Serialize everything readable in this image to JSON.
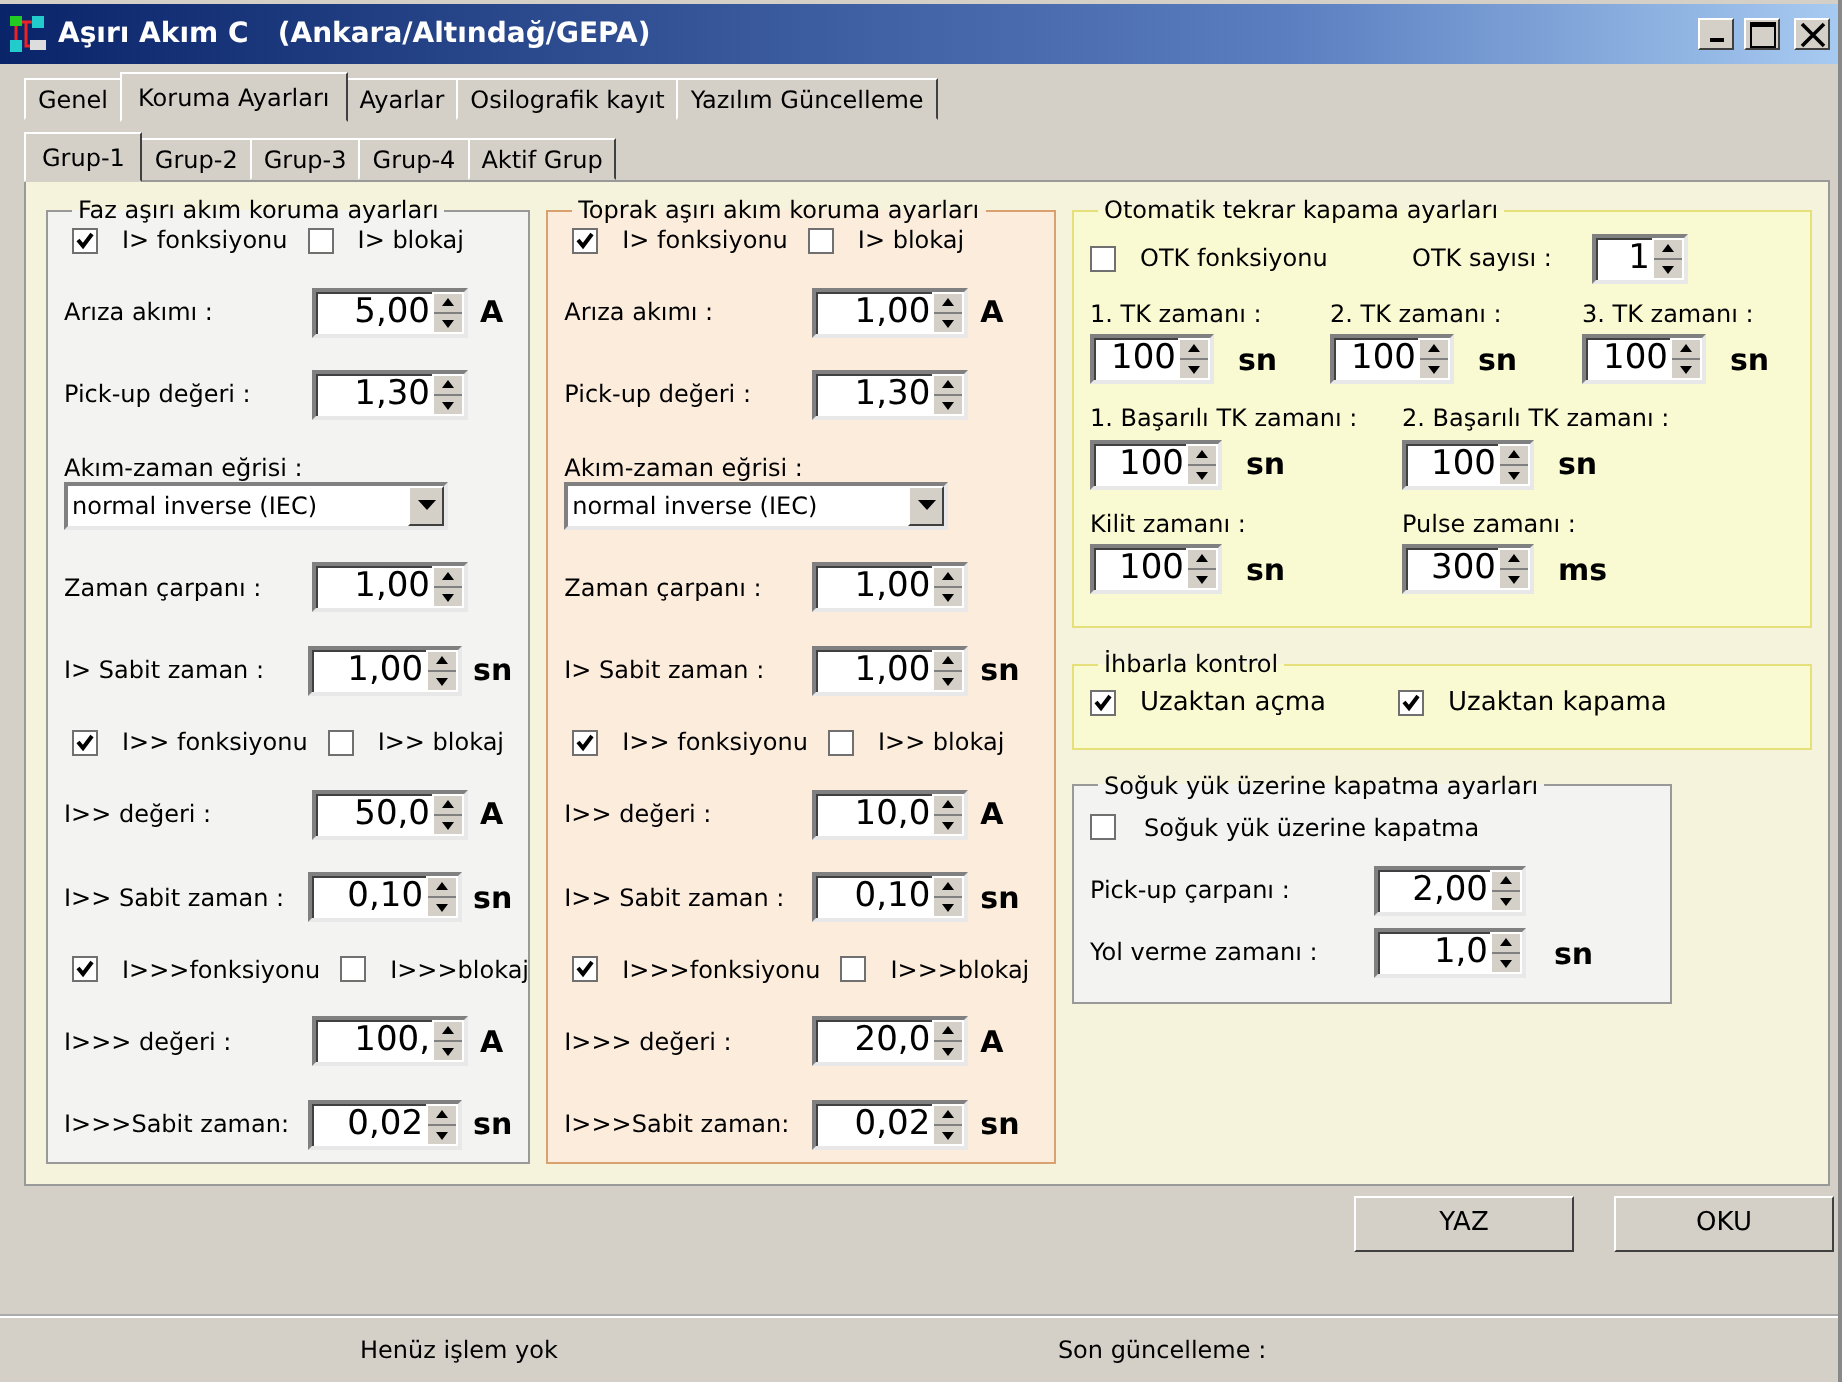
{
  "window": {
    "title": "Aşırı Akım C   (Ankara/Altındağ/GEPA)"
  },
  "tabs": [
    {
      "label": "Genel",
      "selected": false
    },
    {
      "label": "Koruma Ayarları",
      "selected": true
    },
    {
      "label": "Ayarlar",
      "selected": false
    },
    {
      "label": "Osilografik kayıt",
      "selected": false
    },
    {
      "label": "Yazılım Güncelleme",
      "selected": false
    }
  ],
  "subtabs": [
    {
      "label": "Grup-1",
      "selected": true
    },
    {
      "label": "Grup-2",
      "selected": false
    },
    {
      "label": "Grup-3",
      "selected": false
    },
    {
      "label": "Grup-4",
      "selected": false
    },
    {
      "label": "Aktif Grup",
      "selected": false
    }
  ],
  "protection_groups": [
    {
      "title": "Faz aşırı akım koruma ayarları",
      "items": [
        {
          "kind": "checks",
          "items": [
            {
              "label": "I> fonksiyonu",
              "checked": true
            },
            {
              "label": "I> blokaj",
              "checked": false
            }
          ]
        },
        {
          "kind": "spin",
          "label": "Arıza akımı :",
          "value": "5,00",
          "unit": "A"
        },
        {
          "kind": "spin",
          "label": "Pick-up değeri :",
          "value": "1,30"
        },
        {
          "kind": "combo",
          "label": "Akım-zaman eğrisi :",
          "value": "normal inverse (IEC)"
        },
        {
          "kind": "spin",
          "label": "Zaman çarpanı :",
          "value": "1,00"
        },
        {
          "kind": "spin",
          "label": "I> Sabit zaman :",
          "value": "1,00",
          "unit": "sn"
        },
        {
          "kind": "checks",
          "items": [
            {
              "label": "I>> fonksiyonu",
              "checked": true
            },
            {
              "label": "I>> blokaj",
              "checked": false
            }
          ]
        },
        {
          "kind": "spin",
          "label": "I>> değeri :",
          "value": "50,0",
          "unit": "A"
        },
        {
          "kind": "spin",
          "label": "I>> Sabit zaman :",
          "value": "0,10",
          "unit": "sn"
        },
        {
          "kind": "checks",
          "items": [
            {
              "label": "I>>>fonksiyonu",
              "checked": true
            },
            {
              "label": "I>>>blokaj",
              "checked": false
            }
          ]
        },
        {
          "kind": "spin",
          "label": "I>>> değeri :",
          "value": "100,",
          "unit": "A"
        },
        {
          "kind": "spin",
          "label": "I>>>Sabit zaman:",
          "value": "0,02",
          "unit": "sn"
        }
      ]
    },
    {
      "title": "Toprak aşırı akım koruma ayarları",
      "items": [
        {
          "kind": "checks",
          "items": [
            {
              "label": "I> fonksiyonu",
              "checked": true
            },
            {
              "label": "I> blokaj",
              "checked": false
            }
          ]
        },
        {
          "kind": "spin",
          "label": "Arıza akımı :",
          "value": "1,00",
          "unit": "A"
        },
        {
          "kind": "spin",
          "label": "Pick-up değeri :",
          "value": "1,30"
        },
        {
          "kind": "combo",
          "label": "Akım-zaman eğrisi :",
          "value": "normal inverse (IEC)"
        },
        {
          "kind": "spin",
          "label": "Zaman çarpanı :",
          "value": "1,00"
        },
        {
          "kind": "spin",
          "label": "I> Sabit zaman :",
          "value": "1,00",
          "unit": "sn"
        },
        {
          "kind": "checks",
          "items": [
            {
              "label": "I>> fonksiyonu",
              "checked": true
            },
            {
              "label": "I>> blokaj",
              "checked": false
            }
          ]
        },
        {
          "kind": "spin",
          "label": "I>> değeri :",
          "value": "10,0",
          "unit": "A"
        },
        {
          "kind": "spin",
          "label": "I>> Sabit zaman :",
          "value": "0,10",
          "unit": "sn"
        },
        {
          "kind": "checks",
          "items": [
            {
              "label": "I>>>fonksiyonu",
              "checked": true
            },
            {
              "label": "I>>>blokaj",
              "checked": false
            }
          ]
        },
        {
          "kind": "spin",
          "label": "I>>> değeri :",
          "value": "20,0",
          "unit": "A"
        },
        {
          "kind": "spin",
          "label": "I>>>Sabit zaman:",
          "value": "0,02",
          "unit": "sn"
        }
      ]
    }
  ],
  "reclose": {
    "title": "Otomatik tekrar kapama ayarları",
    "function": {
      "label": "OTK fonksiyonu",
      "checked": false
    },
    "count": {
      "label": "OTK sayısı :",
      "value": "1"
    },
    "rows": [
      [
        {
          "label": "1. TK zamanı :",
          "value": "100",
          "unit": "sn"
        },
        {
          "label": "2. TK zamanı :",
          "value": "100",
          "unit": "sn"
        },
        {
          "label": "3. TK zamanı :",
          "value": "100",
          "unit": "sn"
        }
      ],
      [
        {
          "label": "1. Başarılı TK zamanı :",
          "value": "100",
          "unit": "sn"
        },
        {
          "label": "2. Başarılı TK zamanı :",
          "value": "100",
          "unit": "sn"
        }
      ],
      [
        {
          "label": "Kilit zamanı :",
          "value": "100",
          "unit": "sn"
        },
        {
          "label": "Pulse zamanı :",
          "value": "300",
          "unit": "ms"
        }
      ]
    ]
  },
  "remote_control": {
    "title": "İhbarla kontrol",
    "items": [
      {
        "label": "Uzaktan açma",
        "checked": true
      },
      {
        "label": "Uzaktan kapama",
        "checked": true
      }
    ]
  },
  "cold_load": {
    "title": "Soğuk yük üzerine kapatma ayarları",
    "enable": {
      "label": "Soğuk yük üzerine kapatma",
      "checked": false
    },
    "fields": [
      {
        "label": "Pick-up çarpanı :",
        "value": "2,00"
      },
      {
        "label": "Yol verme zamanı :",
        "value": "1,0",
        "unit": "sn"
      }
    ]
  },
  "buttons": [
    "YAZ",
    "OKU"
  ],
  "status_bar": [
    "Henüz işlem yok",
    "Son güncelleme :"
  ]
}
